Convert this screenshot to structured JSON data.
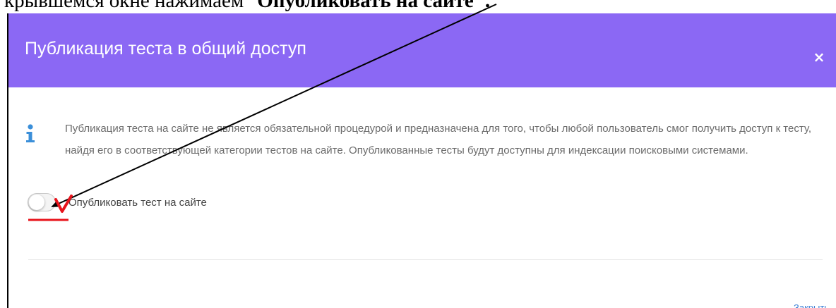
{
  "document": {
    "text_before": "крывшемся окне  нажимаем \"",
    "text_bold": "Опубликовать на сайте",
    "text_after": "\"."
  },
  "modal": {
    "title": "Публикация теста в общий доступ",
    "close_symbol": "×",
    "info_icon": "info-icon",
    "info_text": "Публикация теста на сайте не является обязательной процедурой и предназначена для того, чтобы любой пользователь смог получить доступ к тесту, найдя его в соответствующей категории тестов на сайте. Опубликованные тесты будут доступны для индексации поисковыми системами.",
    "toggle": {
      "label": "Опубликовать тест на сайте",
      "checked": false
    },
    "close_link": "Закрыть"
  },
  "annotations": {
    "arrow": "arrow-annotation",
    "checkmark": "red-checkmark-annotation",
    "underline": "red-underline-annotation"
  },
  "colors": {
    "header": "#8b68f4",
    "info_icon": "#3b8fd9",
    "link": "#3b7fd6",
    "annotation_red": "#e8131b"
  }
}
